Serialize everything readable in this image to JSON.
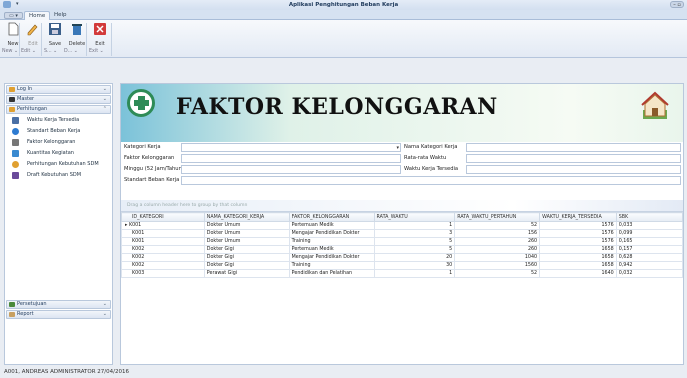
{
  "window": {
    "title": "Aplikasi Penghitungan Beban Kerja",
    "min_max": "– ▫"
  },
  "tabs": {
    "menu": "▭ ▾",
    "home": "Home",
    "help": "Help"
  },
  "ribbon": {
    "buttons": [
      "New",
      "Edit",
      "Save",
      "Delete",
      "Exit"
    ],
    "groups": [
      "New ⌄",
      "Edit ⌄",
      "S... ⌄",
      "D... ⌄",
      "Exit ⌄"
    ]
  },
  "nav": {
    "headers": [
      "Log In",
      "Master",
      "Perhitungan",
      "Persetujuan",
      "Report"
    ],
    "items": [
      "Waktu Kerja Tersedia",
      "Standart Beban Kerja",
      "Faktor Kelonggaran",
      "Kuantitas Kegiatan",
      "Perhitungan Kebutuhan SDM",
      "Draft Kebutuhan SDM"
    ]
  },
  "banner": {
    "title": "FAKTOR KELONGGARAN"
  },
  "form": {
    "kategori_label": "Kategori Kerja",
    "faktor_label": "Faktor Kelonggaran",
    "minggu_label": "Minggu (52 Jam/Tahun)",
    "standart_label": "Standart Beban Kerja",
    "nama_label": "Nama Kategori Kerja",
    "rata_label": "Rata-rata Waktu",
    "waktu_label": "Waktu Kerja Tersedia",
    "kategori_value": "",
    "nama_value": "",
    "rata_value": "",
    "waktu_value": "",
    "faktor_value": "",
    "minggu_value": "",
    "standart_value": ""
  },
  "grid": {
    "group_hint": "Drag a column header here to group by that column",
    "columns": [
      "ID_KATEGORI",
      "NAMA_KATEGORI_KERJA",
      "FAKTOR_KELONGGARAN",
      "RATA_WAKTU",
      "RATA_WAKTU_PERTAHUN",
      "WAKTU_KERJA_TERSEDIA",
      "SBK"
    ],
    "rows": [
      [
        "K001",
        "Dokter Umum",
        "Pertemuan Medik",
        "1",
        "52",
        "1576",
        "0,033"
      ],
      [
        "K001",
        "Dokter Umum",
        "Mengajar Pendidikan Dokter",
        "3",
        "156",
        "1576",
        "0,099"
      ],
      [
        "K001",
        "Dokter Umum",
        "Training",
        "5",
        "260",
        "1576",
        "0,165"
      ],
      [
        "K002",
        "Dokter Gigi",
        "Pertemuan Medik",
        "5",
        "260",
        "1658",
        "0,157"
      ],
      [
        "K002",
        "Dokter Gigi",
        "Mengajar Pendidikan Dokter",
        "20",
        "1040",
        "1658",
        "0,628"
      ],
      [
        "K002",
        "Dokter Gigi",
        "Training",
        "30",
        "1560",
        "1658",
        "0,942"
      ],
      [
        "K003",
        "Perawat Gigi",
        "Pendidikan dan Pelatihan",
        "1",
        "52",
        "1640",
        "0,032"
      ]
    ]
  },
  "status": {
    "text": "A001, ANDREAS ADMINISTRATOR 27/04/2016"
  },
  "colors": {
    "accent": "#2e8b57",
    "frame": "#b9c8dc",
    "banner": "#7bc2d9"
  }
}
